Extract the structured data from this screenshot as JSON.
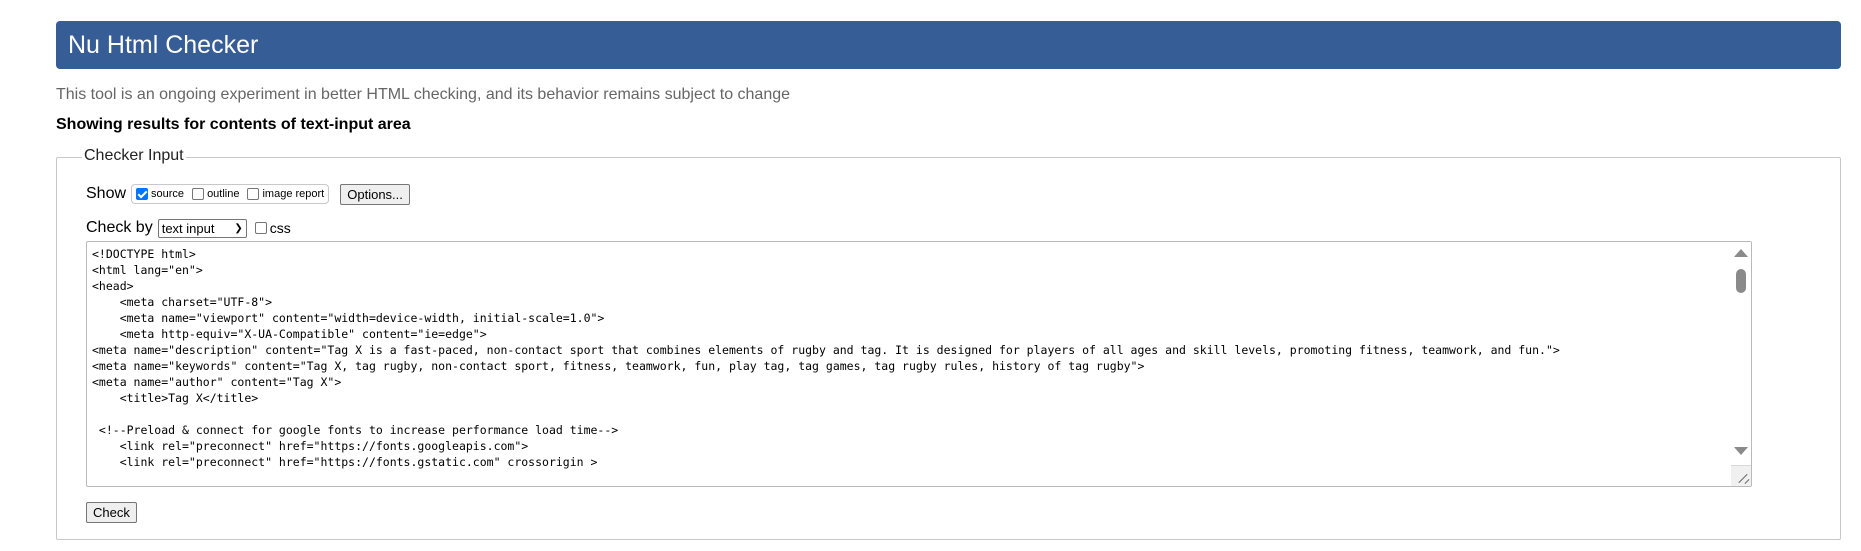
{
  "header": {
    "title": "Nu Html Checker",
    "background": "#365d95"
  },
  "intro": "This tool is an ongoing experiment in better HTML checking, and its behavior remains subject to change",
  "results_heading": "Showing results for contents of text-input area",
  "checker_input": {
    "legend": "Checker Input",
    "show": {
      "label": "Show",
      "options": [
        {
          "label": "source",
          "checked": true
        },
        {
          "label": "outline",
          "checked": false
        },
        {
          "label": "image report",
          "checked": false
        }
      ],
      "options_button": "Options..."
    },
    "check_by": {
      "label": "Check by",
      "selected": "text input",
      "css_label": "css",
      "css_checked": false
    },
    "source_lines": [
      "<!DOCTYPE html>",
      "<html lang=\"en\">",
      "<head>",
      "    <meta charset=\"UTF-8\">",
      "    <meta name=\"viewport\" content=\"width=device-width, initial-scale=1.0\">",
      "    <meta http-equiv=\"X-UA-Compatible\" content=\"ie=edge\">",
      "<meta name=\"description\" content=\"Tag X is a fast-paced, non-contact sport that combines elements of rugby and tag. It is designed for players of all ages and skill levels, promoting fitness, teamwork, and fun.\">",
      "<meta name=\"keywords\" content=\"Tag X, tag rugby, non-contact sport, fitness, teamwork, fun, play tag, tag games, tag rugby rules, history of tag rugby\">",
      "<meta name=\"author\" content=\"Tag X\">",
      "    <title>Tag X</title>",
      "",
      " <!--Preload & connect for google fonts to increase performance load time-->",
      "    <link rel=\"preconnect\" href=\"https://fonts.googleapis.com\">",
      "    <link rel=\"preconnect\" href=\"https://fonts.gstatic.com\" crossorigin >"
    ],
    "check_button": "Check"
  }
}
